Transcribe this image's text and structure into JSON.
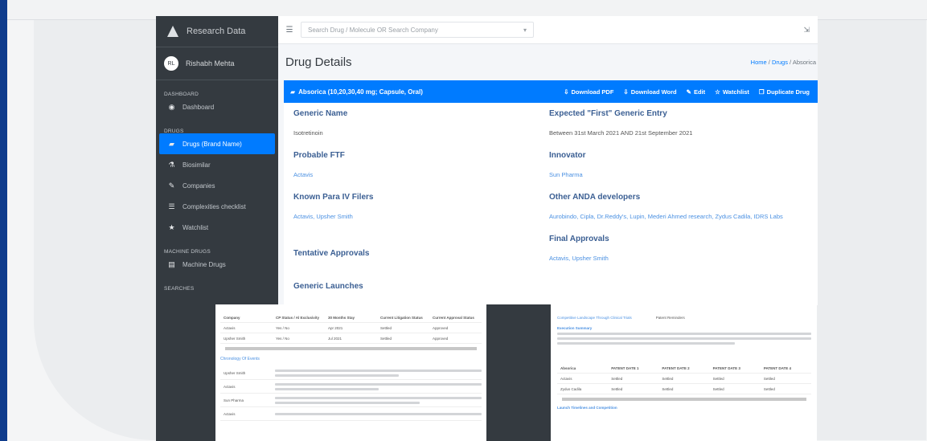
{
  "brand": {
    "name": "Research Data"
  },
  "user": {
    "initials": "RL",
    "name": "Rishabh Mehta"
  },
  "sidebar": {
    "sections": [
      "DASHBOARD",
      "DRUGS",
      "MACHINE DRUGS",
      "SEARCHES"
    ],
    "items": [
      {
        "label": "Dashboard",
        "icon": "dashboard-icon",
        "glyph": "◉"
      },
      {
        "label": "Drugs (Brand Name)",
        "icon": "pills-icon",
        "glyph": "▰",
        "active": true
      },
      {
        "label": "Biosimilar",
        "icon": "flask-icon",
        "glyph": "⚗"
      },
      {
        "label": "Companies",
        "icon": "pen-icon",
        "glyph": "✎"
      },
      {
        "label": "Complexities checklist",
        "icon": "list-icon",
        "glyph": "☰"
      },
      {
        "label": "Watchlist",
        "icon": "star-icon",
        "glyph": "★"
      },
      {
        "label": "Machine Drugs",
        "icon": "document-icon",
        "glyph": "▤"
      }
    ]
  },
  "topbar": {
    "search_placeholder": "Search Drug / Molecule OR Search Company"
  },
  "page": {
    "title": "Drug Details",
    "breadcrumb": [
      "Home",
      "Drugs",
      "Absorica"
    ]
  },
  "card": {
    "header": "Absorica (10,20,30,40 mg; Capsule, Oral)",
    "actions": [
      "Download PDF",
      "Download Word",
      "Edit",
      "Watchlist",
      "Duplicate Drug"
    ]
  },
  "details": {
    "generic_name_label": "Generic Name",
    "generic_name": "Isotretinoin",
    "probable_ftf_label": "Probable FTF",
    "probable_ftf": "Actavis",
    "known_para_label": "Known Para IV Filers",
    "known_para": "Actavis, Upsher Smith",
    "tentative_label": "Tentative Approvals",
    "generic_launches_label": "Generic Launches",
    "expected_label": "Expected \"First\" Generic Entry",
    "expected": "Between 31st March 2021 AND 21st September 2021",
    "innovator_label": "Innovator",
    "innovator": "Sun Pharma",
    "other_anda_label": "Other ANDA developers",
    "other_anda": "Aurobindo, Cipla, Dr.Reddy's, Lupin, Mederi Ahmed research, Zydus Cadila, IDRS Labs",
    "final_label": "Final Approvals",
    "final": "Actavis, Upsher Smith"
  },
  "preview_a": {
    "headers": [
      "Company",
      "CP Status / Al Exclusivity",
      "30 Months Stay",
      "Current Litigation Status",
      "Current Approval Status"
    ],
    "rows": [
      [
        "Actavis",
        "Yes / No",
        "Apr 2021",
        "Settled",
        "Approved"
      ],
      [
        "Upsher Smith",
        "Yes / No",
        "Jul 2021",
        "Settled",
        "Approved"
      ]
    ],
    "chronology": "Chronology Of Events",
    "entries": [
      "Upsher Smith",
      "Actavis",
      "Sun Pharma",
      "Actavis"
    ]
  },
  "preview_b": {
    "link1": "Competitive Landscape Through Clinical Trials",
    "link2": "Patent Reminders",
    "section": "Execution Summary",
    "table_head": [
      "Absorica",
      "PATENT DATE 1",
      "PATENT DATE 2",
      "PATENT DATE 3",
      "PATENT DATE 4"
    ],
    "rows": [
      [
        "Actavis",
        "Settled",
        "Settled",
        "Settled",
        "Settled"
      ],
      [
        "Zydus Cadila",
        "Settled",
        "Settled",
        "Settled",
        "Settled"
      ]
    ],
    "footer": "Launch Timelines and Competition"
  }
}
